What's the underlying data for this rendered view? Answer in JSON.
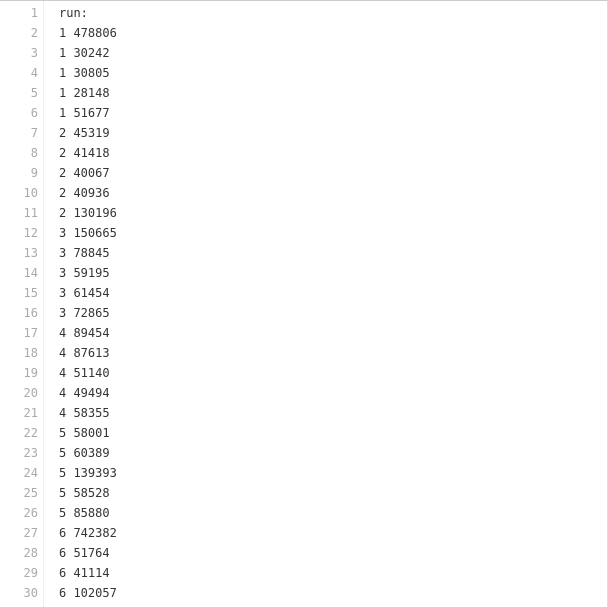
{
  "editor": {
    "lines": [
      {
        "number": "1",
        "text": "run:"
      },
      {
        "number": "2",
        "text": "1 478806"
      },
      {
        "number": "3",
        "text": "1 30242"
      },
      {
        "number": "4",
        "text": "1 30805"
      },
      {
        "number": "5",
        "text": "1 28148"
      },
      {
        "number": "6",
        "text": "1 51677"
      },
      {
        "number": "7",
        "text": "2 45319"
      },
      {
        "number": "8",
        "text": "2 41418"
      },
      {
        "number": "9",
        "text": "2 40067"
      },
      {
        "number": "10",
        "text": "2 40936"
      },
      {
        "number": "11",
        "text": "2 130196"
      },
      {
        "number": "12",
        "text": "3 150665"
      },
      {
        "number": "13",
        "text": "3 78845"
      },
      {
        "number": "14",
        "text": "3 59195"
      },
      {
        "number": "15",
        "text": "3 61454"
      },
      {
        "number": "16",
        "text": "3 72865"
      },
      {
        "number": "17",
        "text": "4 89454"
      },
      {
        "number": "18",
        "text": "4 87613"
      },
      {
        "number": "19",
        "text": "4 51140"
      },
      {
        "number": "20",
        "text": "4 49494"
      },
      {
        "number": "21",
        "text": "4 58355"
      },
      {
        "number": "22",
        "text": "5 58001"
      },
      {
        "number": "23",
        "text": "5 60389"
      },
      {
        "number": "24",
        "text": "5 139393"
      },
      {
        "number": "25",
        "text": "5 58528"
      },
      {
        "number": "26",
        "text": "5 85880"
      },
      {
        "number": "27",
        "text": "6 742382"
      },
      {
        "number": "28",
        "text": "6 51764"
      },
      {
        "number": "29",
        "text": "6 41114"
      },
      {
        "number": "30",
        "text": "6 102057"
      }
    ]
  }
}
